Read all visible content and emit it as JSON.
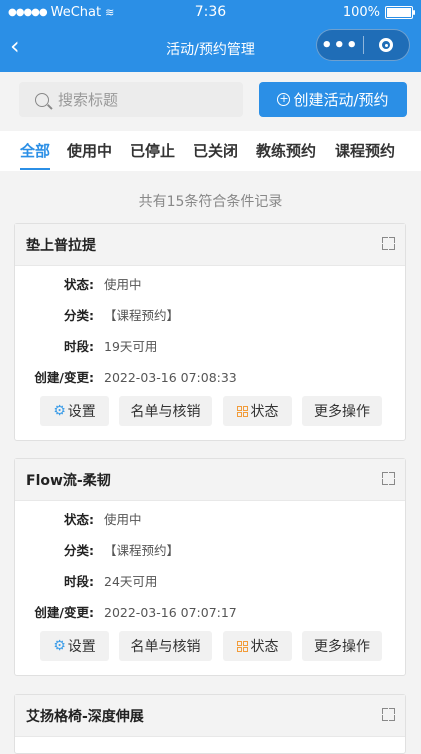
{
  "status_bar": {
    "carrier": "WeChat",
    "time": "7:36",
    "battery": "100%"
  },
  "nav": {
    "title": "活动/预约管理",
    "menu_glyph": "•••"
  },
  "search": {
    "placeholder": "搜索标题"
  },
  "create_button": {
    "label": "创建活动/预约"
  },
  "tabs": [
    {
      "label": "全部",
      "active": true
    },
    {
      "label": "使用中"
    },
    {
      "label": "已停止"
    },
    {
      "label": "已关闭"
    },
    {
      "label": "教练预约"
    },
    {
      "label": "课程预约"
    }
  ],
  "summary": "共有15条符合条件记录",
  "labels": {
    "status": "状态:",
    "category": "分类:",
    "period": "时段:",
    "created": "创建/变更:"
  },
  "actions": {
    "settings": "设置",
    "roster": "名单与核销",
    "status": "状态",
    "more": "更多操作"
  },
  "cards": [
    {
      "title": "垫上普拉提",
      "status": "使用中",
      "category": "【课程预约】",
      "period": "19天可用",
      "created": "2022-03-16 07:08:33"
    },
    {
      "title": "Flow流-柔韧",
      "status": "使用中",
      "category": "【课程预约】",
      "period": "24天可用",
      "created": "2022-03-16 07:07:17"
    },
    {
      "title": "艾扬格椅-深度伸展"
    }
  ],
  "colors": {
    "primary": "#2b8fe6",
    "status_icon": "#f29c3a"
  }
}
